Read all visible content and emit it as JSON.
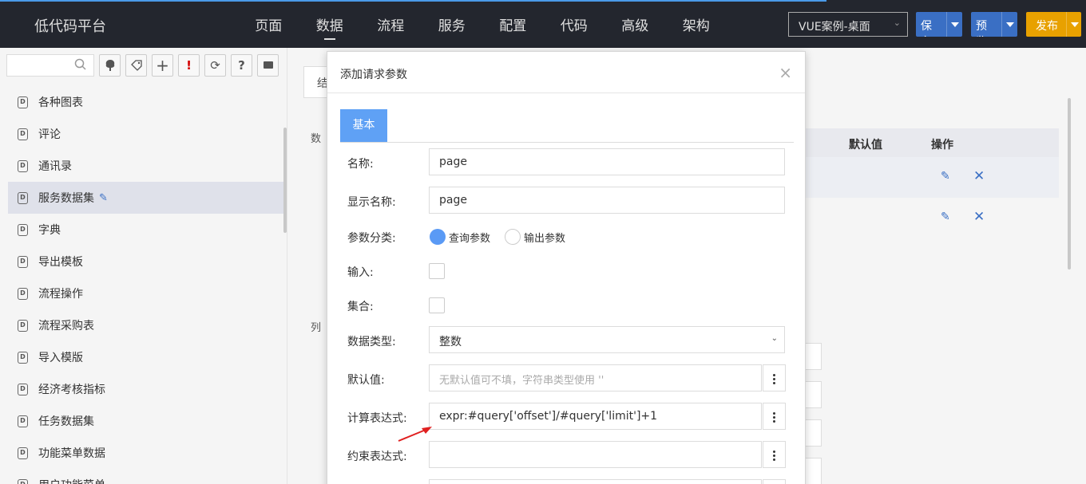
{
  "topbar": {
    "brand": "低代码平台",
    "nav": [
      "页面",
      "数据",
      "流程",
      "服务",
      "配置",
      "代码",
      "高级",
      "架构"
    ],
    "active_nav": "数据",
    "project": "VUE案例-桌面",
    "save": "保存",
    "preview": "预览",
    "publish": "发布",
    "colors": {
      "bar": "#23262e",
      "save": "#3a6fc4",
      "publish": "#e8a100"
    }
  },
  "sidebar": {
    "tools": [
      "tree-icon",
      "tag-icon",
      "plus-icon",
      "alert-icon",
      "refresh-icon",
      "help-icon",
      "message-icon"
    ],
    "items": [
      "各种图表",
      "评论",
      "通讯录",
      "服务数据集",
      "字典",
      "导出模板",
      "流程操作",
      "流程采购表",
      "导入模版",
      "经济考核指标",
      "任务数据集",
      "功能菜单数据",
      "用户功能菜单"
    ],
    "selected": "服务数据集"
  },
  "background": {
    "tab_partial": "结",
    "label1": "数",
    "label2": "列",
    "col_default": "默认值",
    "col_action": "操作"
  },
  "dialog": {
    "title": "添加请求参数",
    "tab": "基本",
    "fields": {
      "name_label": "名称:",
      "name_value": "page",
      "display_label": "显示名称:",
      "display_value": "page",
      "category_label": "参数分类:",
      "radio_query": "查询参数",
      "radio_output": "输出参数",
      "input_label": "输入:",
      "collection_label": "集合:",
      "type_label": "数据类型:",
      "type_value": "整数",
      "default_label": "默认值:",
      "default_placeholder": "无默认值可不填，字符串类型使用 ''",
      "expr_label": "计算表达式:",
      "expr_value": "expr:#query['offset']/#query['limit']+1",
      "constraint_label": "约束表达式:"
    }
  }
}
